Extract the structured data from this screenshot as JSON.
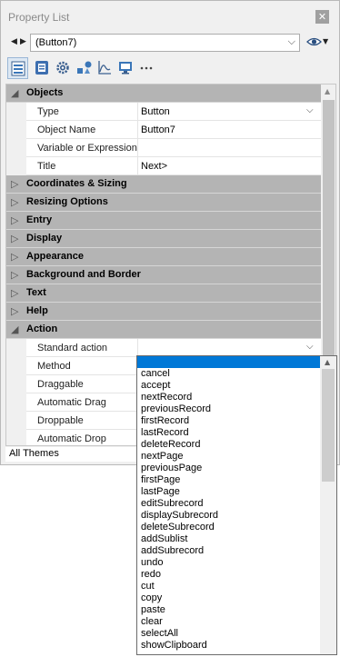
{
  "window": {
    "title": "Property List",
    "close_symbol": "✕"
  },
  "nav": {
    "prev_symbol": "◀",
    "next_symbol": "▶",
    "selected_object": "(Button7)",
    "dropdown_symbol": "⌵",
    "eye_caret": "▼"
  },
  "toolbar": {
    "buttons": [
      {
        "icon": "property-list-icon",
        "active": true
      },
      {
        "icon": "form-icon",
        "active": false
      },
      {
        "icon": "gear-icon",
        "active": false
      },
      {
        "icon": "shapes-icon",
        "active": false
      },
      {
        "icon": "chart-icon",
        "active": false
      },
      {
        "icon": "monitor-icon",
        "active": false
      },
      {
        "icon": "more-icon",
        "active": false
      }
    ]
  },
  "grid": {
    "objects": {
      "label": "Objects",
      "arrow": "◢"
    },
    "props_objects": [
      {
        "name": "Type",
        "value": "Button",
        "dropdown": true
      },
      {
        "name": "Object Name",
        "value": "Button7",
        "dropdown": false
      },
      {
        "name": "Variable or Expression",
        "value": "",
        "dropdown": false
      },
      {
        "name": "Title",
        "value": "Next>",
        "dropdown": false
      }
    ],
    "collapsed": [
      {
        "label": "Coordinates & Sizing",
        "arrow": "▷"
      },
      {
        "label": "Resizing Options",
        "arrow": "▷"
      },
      {
        "label": "Entry",
        "arrow": "▷"
      },
      {
        "label": "Display",
        "arrow": "▷"
      },
      {
        "label": "Appearance",
        "arrow": "▷"
      },
      {
        "label": "Background and Border",
        "arrow": "▷"
      },
      {
        "label": "Text",
        "arrow": "▷"
      },
      {
        "label": "Help",
        "arrow": "▷"
      }
    ],
    "action": {
      "label": "Action",
      "arrow": "◢"
    },
    "props_action": [
      {
        "name": "Standard action",
        "value": "",
        "dropdown": true
      },
      {
        "name": "Method",
        "value": "",
        "dropdown": false
      },
      {
        "name": "Draggable",
        "value": "",
        "dropdown": false
      },
      {
        "name": "Automatic Drag",
        "value": "",
        "dropdown": false
      },
      {
        "name": "Droppable",
        "value": "",
        "dropdown": false
      },
      {
        "name": "Automatic Drop",
        "value": "",
        "dropdown": false
      }
    ]
  },
  "themes": {
    "label": "All Themes"
  },
  "dropdown_list": {
    "items": [
      "cancel",
      "accept",
      "nextRecord",
      "previousRecord",
      "firstRecord",
      "lastRecord",
      "deleteRecord",
      "nextPage",
      "previousPage",
      "firstPage",
      "lastPage",
      "editSubrecord",
      "displaySubrecord",
      "deleteSubrecord",
      "addSublist",
      "addSubrecord",
      "undo",
      "redo",
      "cut",
      "copy",
      "paste",
      "clear",
      "selectAll",
      "showClipboard"
    ],
    "scroll_up_symbol": "▲"
  },
  "colors": {
    "category_bg": "#b4b4b4",
    "selection": "#0078d7",
    "accent": "#3a76b8"
  }
}
